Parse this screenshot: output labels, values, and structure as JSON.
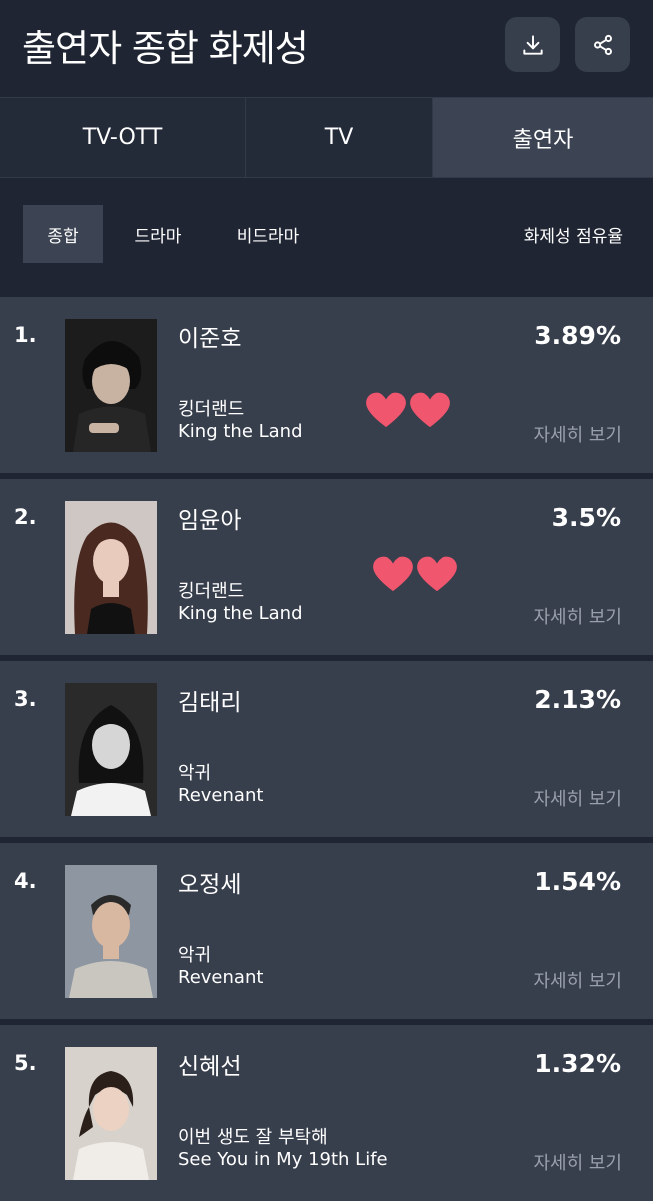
{
  "header": {
    "title": "출연자 종합 화제성",
    "download_icon": "download-icon",
    "share_icon": "share-icon"
  },
  "tabs": [
    {
      "label": "TV-OTT",
      "active": false
    },
    {
      "label": "TV",
      "active": false
    },
    {
      "label": "출연자",
      "active": true
    }
  ],
  "filters": {
    "chips": [
      {
        "label": "종합",
        "active": true
      },
      {
        "label": "드라마",
        "active": false
      },
      {
        "label": "비드라마",
        "active": false
      }
    ],
    "share_label": "화제성 점유율"
  },
  "rankings": [
    {
      "rank": "1.",
      "name": "이준호",
      "show_ko": "킹더랜드",
      "show_en": "King the Land",
      "share": "3.89%",
      "detail": "자세히 보기",
      "hearts": true
    },
    {
      "rank": "2.",
      "name": "임윤아",
      "show_ko": "킹더랜드",
      "show_en": "King the Land",
      "share": "3.5%",
      "detail": "자세히 보기",
      "hearts": true
    },
    {
      "rank": "3.",
      "name": "김태리",
      "show_ko": "악귀",
      "show_en": "Revenant",
      "share": "2.13%",
      "detail": "자세히 보기",
      "hearts": false
    },
    {
      "rank": "4.",
      "name": "오정세",
      "show_ko": "악귀",
      "show_en": "Revenant",
      "share": "1.54%",
      "detail": "자세히 보기",
      "hearts": false
    },
    {
      "rank": "5.",
      "name": "신혜선",
      "show_ko": "이번 생도 잘 부탁해",
      "show_en": "See You in My 19th Life",
      "share": "1.32%",
      "detail": "자세히 보기",
      "hearts": false
    }
  ],
  "colors": {
    "background": "#1f2533",
    "row": "#373e4c",
    "active_tab": "#3c4352",
    "muted_text": "#9aa0ab",
    "heart": "#f0566e"
  }
}
